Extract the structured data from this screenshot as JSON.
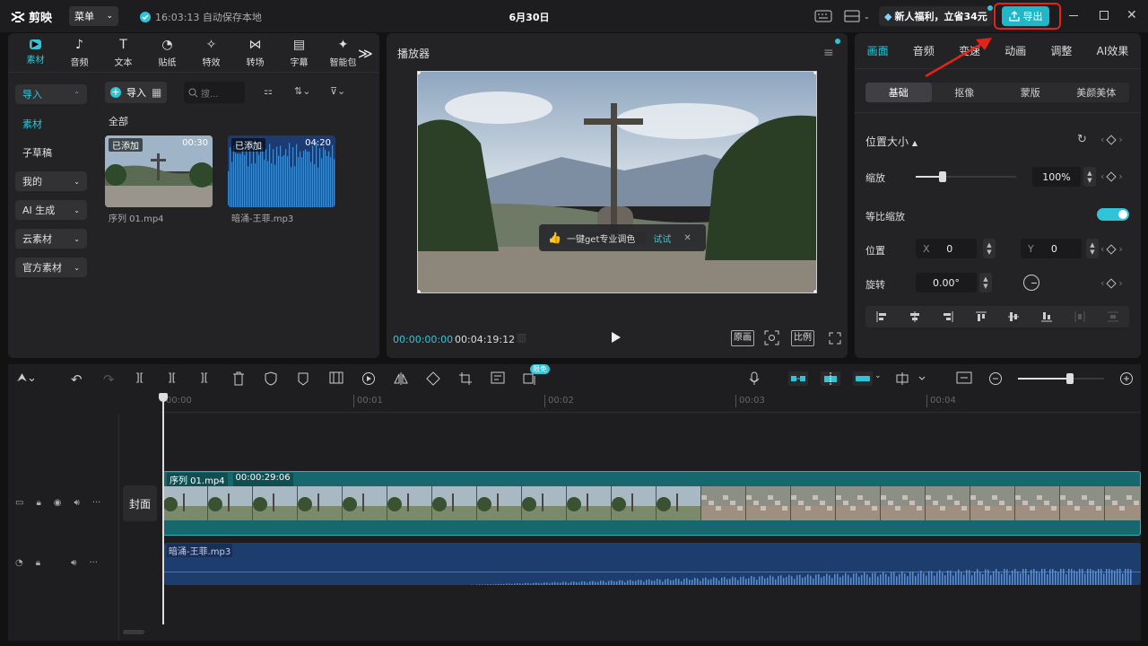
{
  "app": {
    "name": "剪映",
    "menu_label": "菜单",
    "save_status": "16:03:13 自动保存本地",
    "title": "6月30日",
    "promo": "新人福利，立省34元",
    "export_label": "导出"
  },
  "media": {
    "tabs": [
      {
        "label": "素材",
        "icon": "media-icon"
      },
      {
        "label": "音频",
        "icon": "audio-icon"
      },
      {
        "label": "文本",
        "icon": "text-icon"
      },
      {
        "label": "贴纸",
        "icon": "sticker-icon"
      },
      {
        "label": "特效",
        "icon": "effects-icon"
      },
      {
        "label": "转场",
        "icon": "transition-icon"
      },
      {
        "label": "字幕",
        "icon": "subtitle-icon"
      },
      {
        "label": "智能包",
        "icon": "smart-package-icon"
      }
    ],
    "side": [
      "导入",
      "素材",
      "子草稿",
      "我的",
      "AI 生成",
      "云素材",
      "官方素材"
    ],
    "import_btn": "导入",
    "search_placeholder": "搜...",
    "section": "全部",
    "items": [
      {
        "badge": "已添加",
        "duration": "00:30",
        "name": "序列 01.mp4"
      },
      {
        "badge": "已添加",
        "duration": "04:20",
        "name": "暗涌-王菲.mp3"
      }
    ]
  },
  "player": {
    "title": "播放器",
    "tip": "一键get专业调色",
    "tip_action": "试试",
    "time_current": "00:00:00:00",
    "time_total": "00:04:19:12",
    "btn_original": "原画",
    "btn_ratio": "比例"
  },
  "props": {
    "tabs": [
      "画面",
      "音频",
      "变速",
      "动画",
      "调整",
      "AI效果"
    ],
    "subtabs": [
      "基础",
      "抠像",
      "蒙版",
      "美颜美体"
    ],
    "section": "位置大小",
    "scale_label": "缩放",
    "scale_value": "100%",
    "scale_level": 0.27,
    "uniform_label": "等比缩放",
    "uniform_on": true,
    "pos_label": "位置",
    "x_label": "X",
    "x_value": "0",
    "y_label": "Y",
    "y_value": "0",
    "rot_label": "旋转",
    "rot_value": "0.00°"
  },
  "timeline": {
    "badge": "限免",
    "ticks": [
      "00:00",
      "00:01",
      "00:02",
      "00:03",
      "00:04"
    ],
    "cover_label": "封面",
    "video_clip": {
      "name": "序列 01.mp4",
      "duration": "00:00:29:06"
    },
    "audio_clip": {
      "name": "暗涌-王菲.mp3"
    },
    "zoom_level": 0.6
  },
  "colors": {
    "accent": "#2fc4d7",
    "highlight": "#e4231b"
  }
}
